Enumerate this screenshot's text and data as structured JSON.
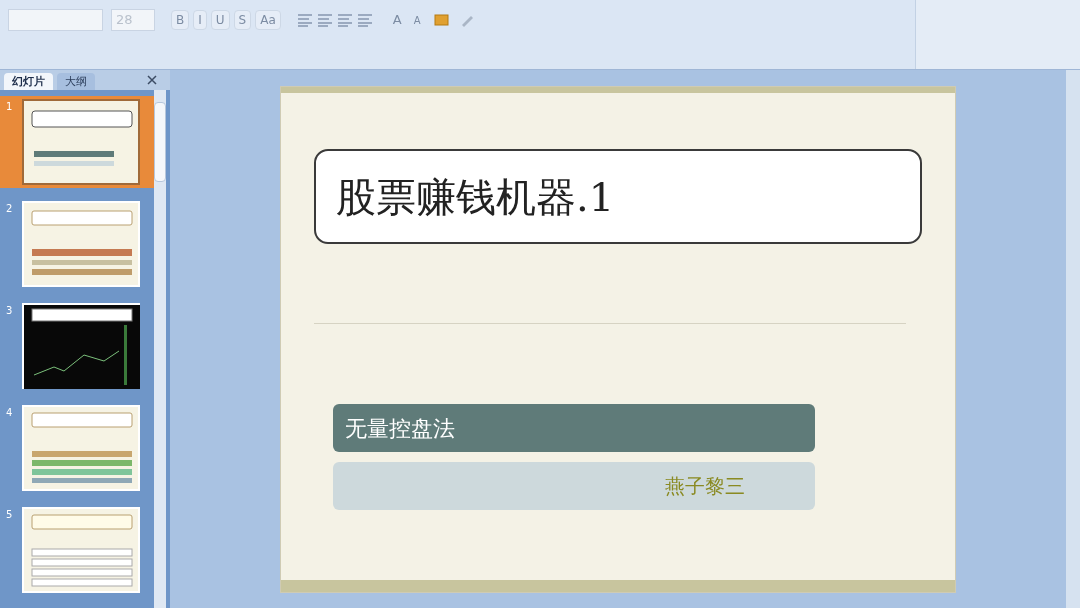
{
  "ribbon": {
    "font_size": "28",
    "format_buttons": [
      "B",
      "I",
      "U",
      "S",
      "Aa"
    ],
    "size_buttons": [
      "A",
      "A"
    ]
  },
  "panel": {
    "tabs": [
      {
        "label": "幻灯片",
        "selected": true
      },
      {
        "label": "大纲",
        "selected": false
      }
    ]
  },
  "slides": [
    {
      "number": "1",
      "selected": true,
      "kind": "title"
    },
    {
      "number": "2",
      "selected": false,
      "kind": "bars"
    },
    {
      "number": "3",
      "selected": false,
      "kind": "chart"
    },
    {
      "number": "4",
      "selected": false,
      "kind": "bars-green"
    },
    {
      "number": "5",
      "selected": false,
      "kind": "list"
    }
  ],
  "slide": {
    "title": "股票赚钱机器.1",
    "subtitle": "无量控盘法",
    "author": "燕子黎三"
  }
}
